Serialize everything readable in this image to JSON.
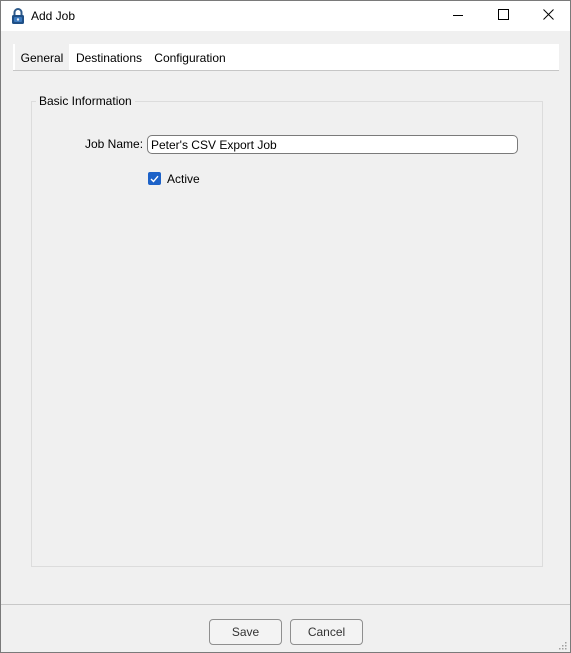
{
  "window": {
    "title": "Add Job",
    "icon": "lock-icon",
    "controls": {
      "minimize": "minimize-icon",
      "maximize": "maximize-icon",
      "close": "close-icon"
    }
  },
  "tabs": [
    {
      "label": "General",
      "selected": true
    },
    {
      "label": "Destinations",
      "selected": false
    },
    {
      "label": "Configuration",
      "selected": false
    }
  ],
  "basic_information": {
    "legend": "Basic Information",
    "job_name_label": "Job Name:",
    "job_name_value": "Peter's CSV Export Job",
    "active_label": "Active",
    "active_checked": true
  },
  "buttons": {
    "save": "Save",
    "cancel": "Cancel"
  },
  "colors": {
    "accent": "#1d62c8",
    "window_bg": "#f0f0f0",
    "titlebar_bg": "#ffffff"
  }
}
